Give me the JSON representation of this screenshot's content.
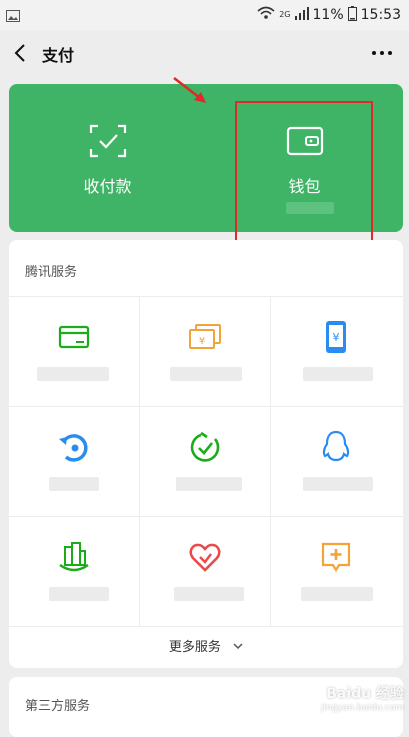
{
  "status_bar": {
    "network_label": "2G",
    "battery": "11%",
    "time": "15:53"
  },
  "nav": {
    "title": "支付",
    "back_icon": "chevron-left-icon",
    "more_icon": "ellipsis-icon"
  },
  "hero": {
    "items": [
      {
        "label": "收付款",
        "icon": "scan-pay-icon"
      },
      {
        "label": "钱包",
        "icon": "wallet-icon"
      }
    ]
  },
  "tencent_services": {
    "title": "腾讯服务",
    "items": [
      {
        "icon": "card-icon",
        "color": "#1aad19"
      },
      {
        "icon": "money-transfer-icon",
        "color": "#f2a33a"
      },
      {
        "icon": "phone-topup-icon",
        "color": "#2a8cf0"
      },
      {
        "icon": "refresh-cycle-icon",
        "color": "#2a8cf0"
      },
      {
        "icon": "check-leaf-icon",
        "color": "#1aad19"
      },
      {
        "icon": "qq-penguin-icon",
        "color": "#2a8cf0"
      },
      {
        "icon": "city-buildings-icon",
        "color": "#1aad19"
      },
      {
        "icon": "charity-heart-icon",
        "color": "#e94b4b"
      },
      {
        "icon": "medical-chat-icon",
        "color": "#f2a33a"
      }
    ],
    "more_label": "更多服务"
  },
  "third_party": {
    "title": "第三方服务"
  },
  "watermark": {
    "main": "Baidu 经验",
    "sub": "jingyan.baidu.com"
  },
  "colors": {
    "hero_green": "#3fb466",
    "highlight_red": "#e02929",
    "background": "#ededed"
  }
}
